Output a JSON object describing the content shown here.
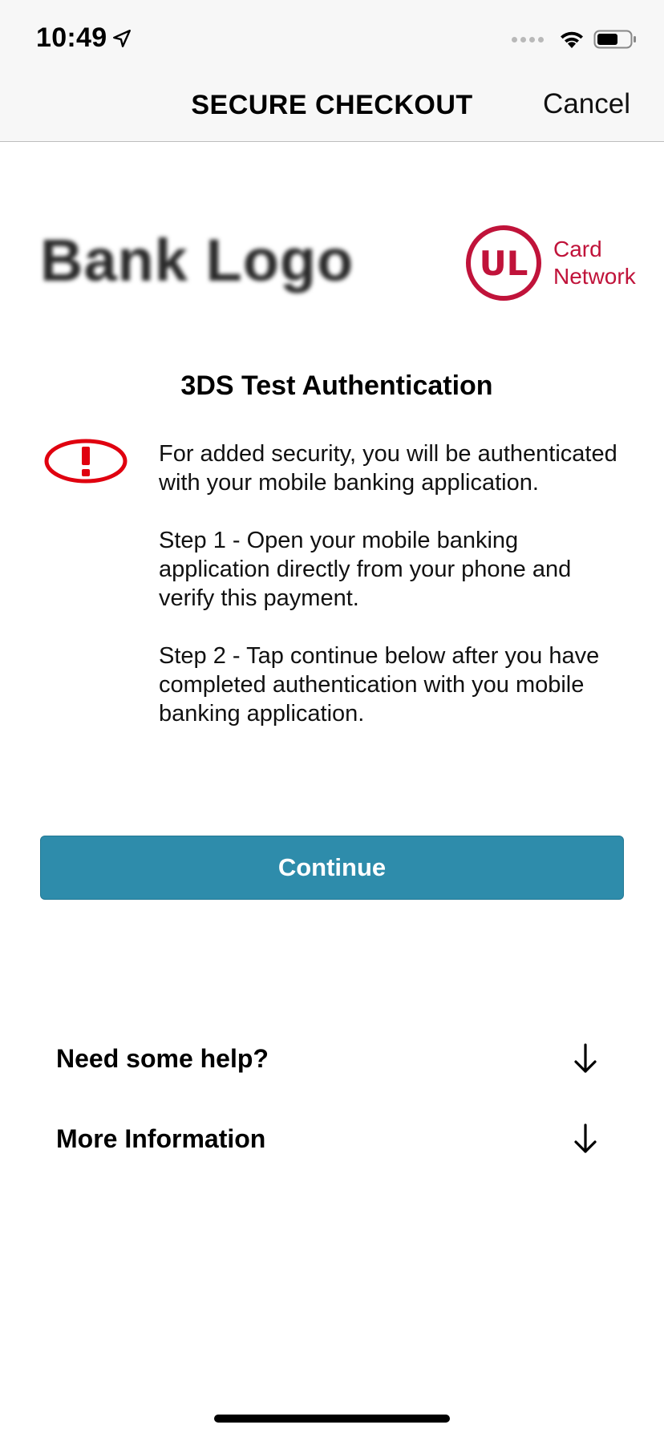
{
  "status_bar": {
    "time": "10:49"
  },
  "nav": {
    "title": "SECURE CHECKOUT",
    "cancel_label": "Cancel"
  },
  "logos": {
    "bank_logo_text": "Bank Logo",
    "card_network_line1": "Card",
    "card_network_line2": "Network",
    "card_network_mark": "UL"
  },
  "content": {
    "heading": "3DS Test Authentication",
    "paragraphs": [
      "For added security, you will be authenticated with your mobile banking application.",
      "Step 1 - Open your mobile banking application directly from your phone and verify this payment.",
      "Step 2 - Tap continue below after you have completed authentication with you mobile banking application."
    ]
  },
  "continue_label": "Continue",
  "expanders": [
    {
      "label": "Need some help?",
      "icon": "arrow-down-icon"
    },
    {
      "label": "More Information",
      "icon": "arrow-down-icon"
    }
  ],
  "colors": {
    "accent": "#2e8cab",
    "alert": "#e0000f",
    "brand": "#c0133a"
  }
}
